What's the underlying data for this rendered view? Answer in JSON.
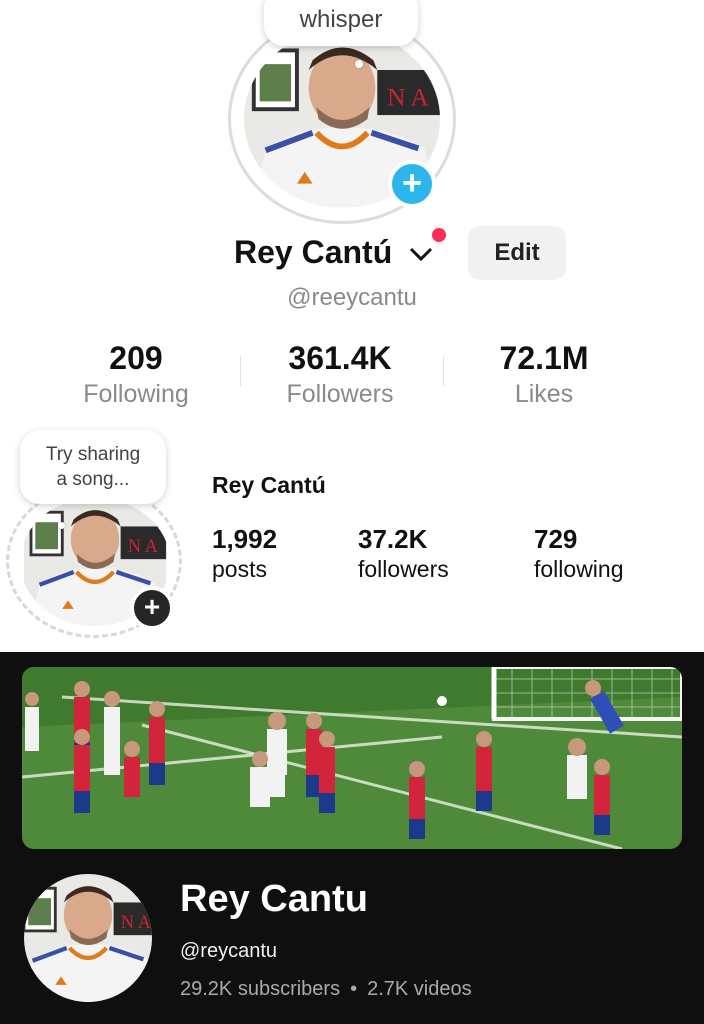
{
  "tiktok": {
    "bubble_text": "whisper",
    "display_name": "Rey Cantú",
    "handle": "@reeycantu",
    "edit_label": "Edit",
    "stats": [
      {
        "value": "209",
        "label": "Following"
      },
      {
        "value": "361.4K",
        "label": "Followers"
      },
      {
        "value": "72.1M",
        "label": "Likes"
      }
    ],
    "plus_icon": "plus-icon",
    "colors": {
      "plus_button": "#2bb7ec",
      "notification_dot": "#fe2c55"
    }
  },
  "instagram": {
    "bubble_line1": "Try sharing",
    "bubble_line2": "a song...",
    "display_name": "Rey Cantú",
    "stats": [
      {
        "value": "1,992",
        "label": "posts"
      },
      {
        "value": "37.2K",
        "label": "followers"
      },
      {
        "value": "729",
        "label": "following"
      }
    ],
    "plus_icon": "plus-icon"
  },
  "youtube": {
    "channel_name": "Rey Cantu",
    "handle": "@reycantu",
    "subscribers": "29.2K subscribers",
    "separator": "•",
    "videos": "2.7K videos",
    "banner_icon": "soccer-match-banner"
  }
}
